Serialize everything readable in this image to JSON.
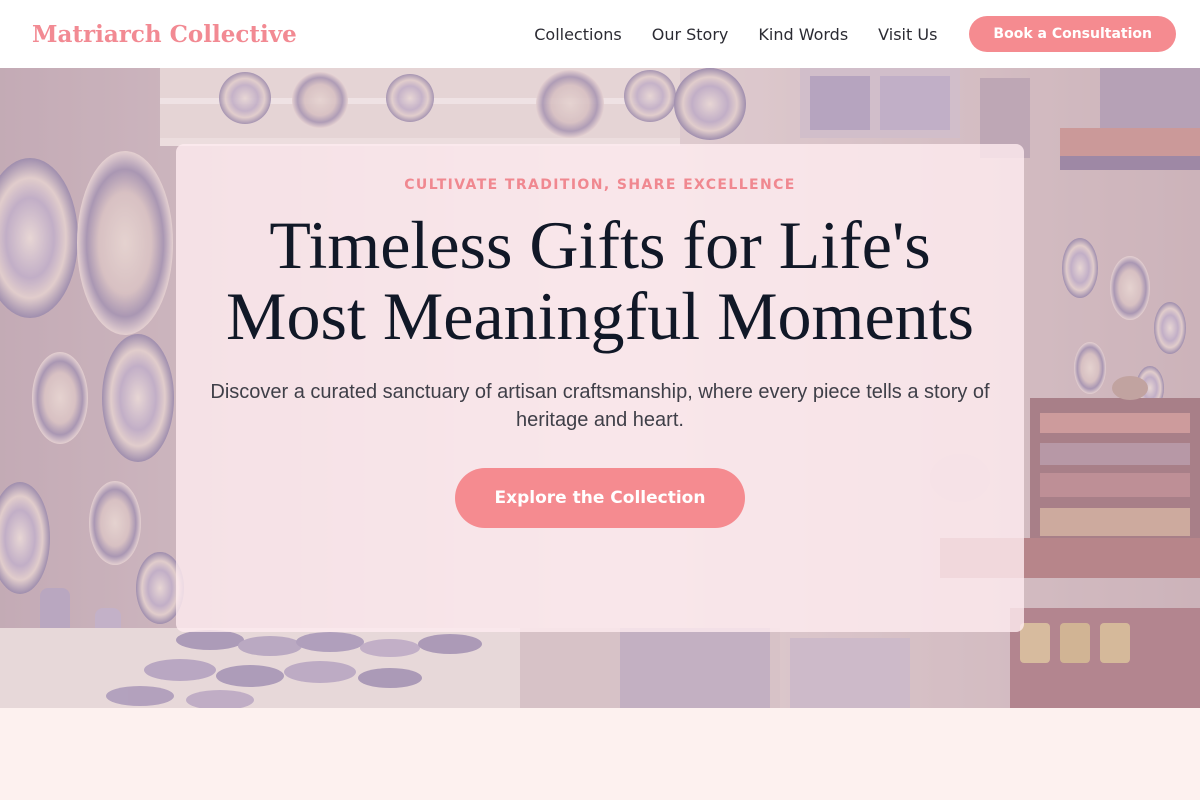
{
  "header": {
    "brand": "Matriarch Collective",
    "nav": [
      {
        "label": "Collections"
      },
      {
        "label": "Our Story"
      },
      {
        "label": "Kind Words"
      },
      {
        "label": "Visit Us"
      }
    ],
    "cta_label": "Book a Consultation"
  },
  "hero": {
    "eyebrow": "CULTIVATE TRADITION, SHARE EXCELLENCE",
    "title": "Timeless Gifts for Life's Most Meaningful Moments",
    "subtitle": "Discover a curated sanctuary of artisan craftsmanship, where every piece tells a story of heritage and heart.",
    "button_label": "Explore the Collection",
    "background_image": "shop-shelves-with-hand-painted-ceramic-plates"
  },
  "colors": {
    "accent": "#f58b90",
    "brand": "#f28a93",
    "heading": "#111827",
    "page_background": "#fdf1ef"
  }
}
